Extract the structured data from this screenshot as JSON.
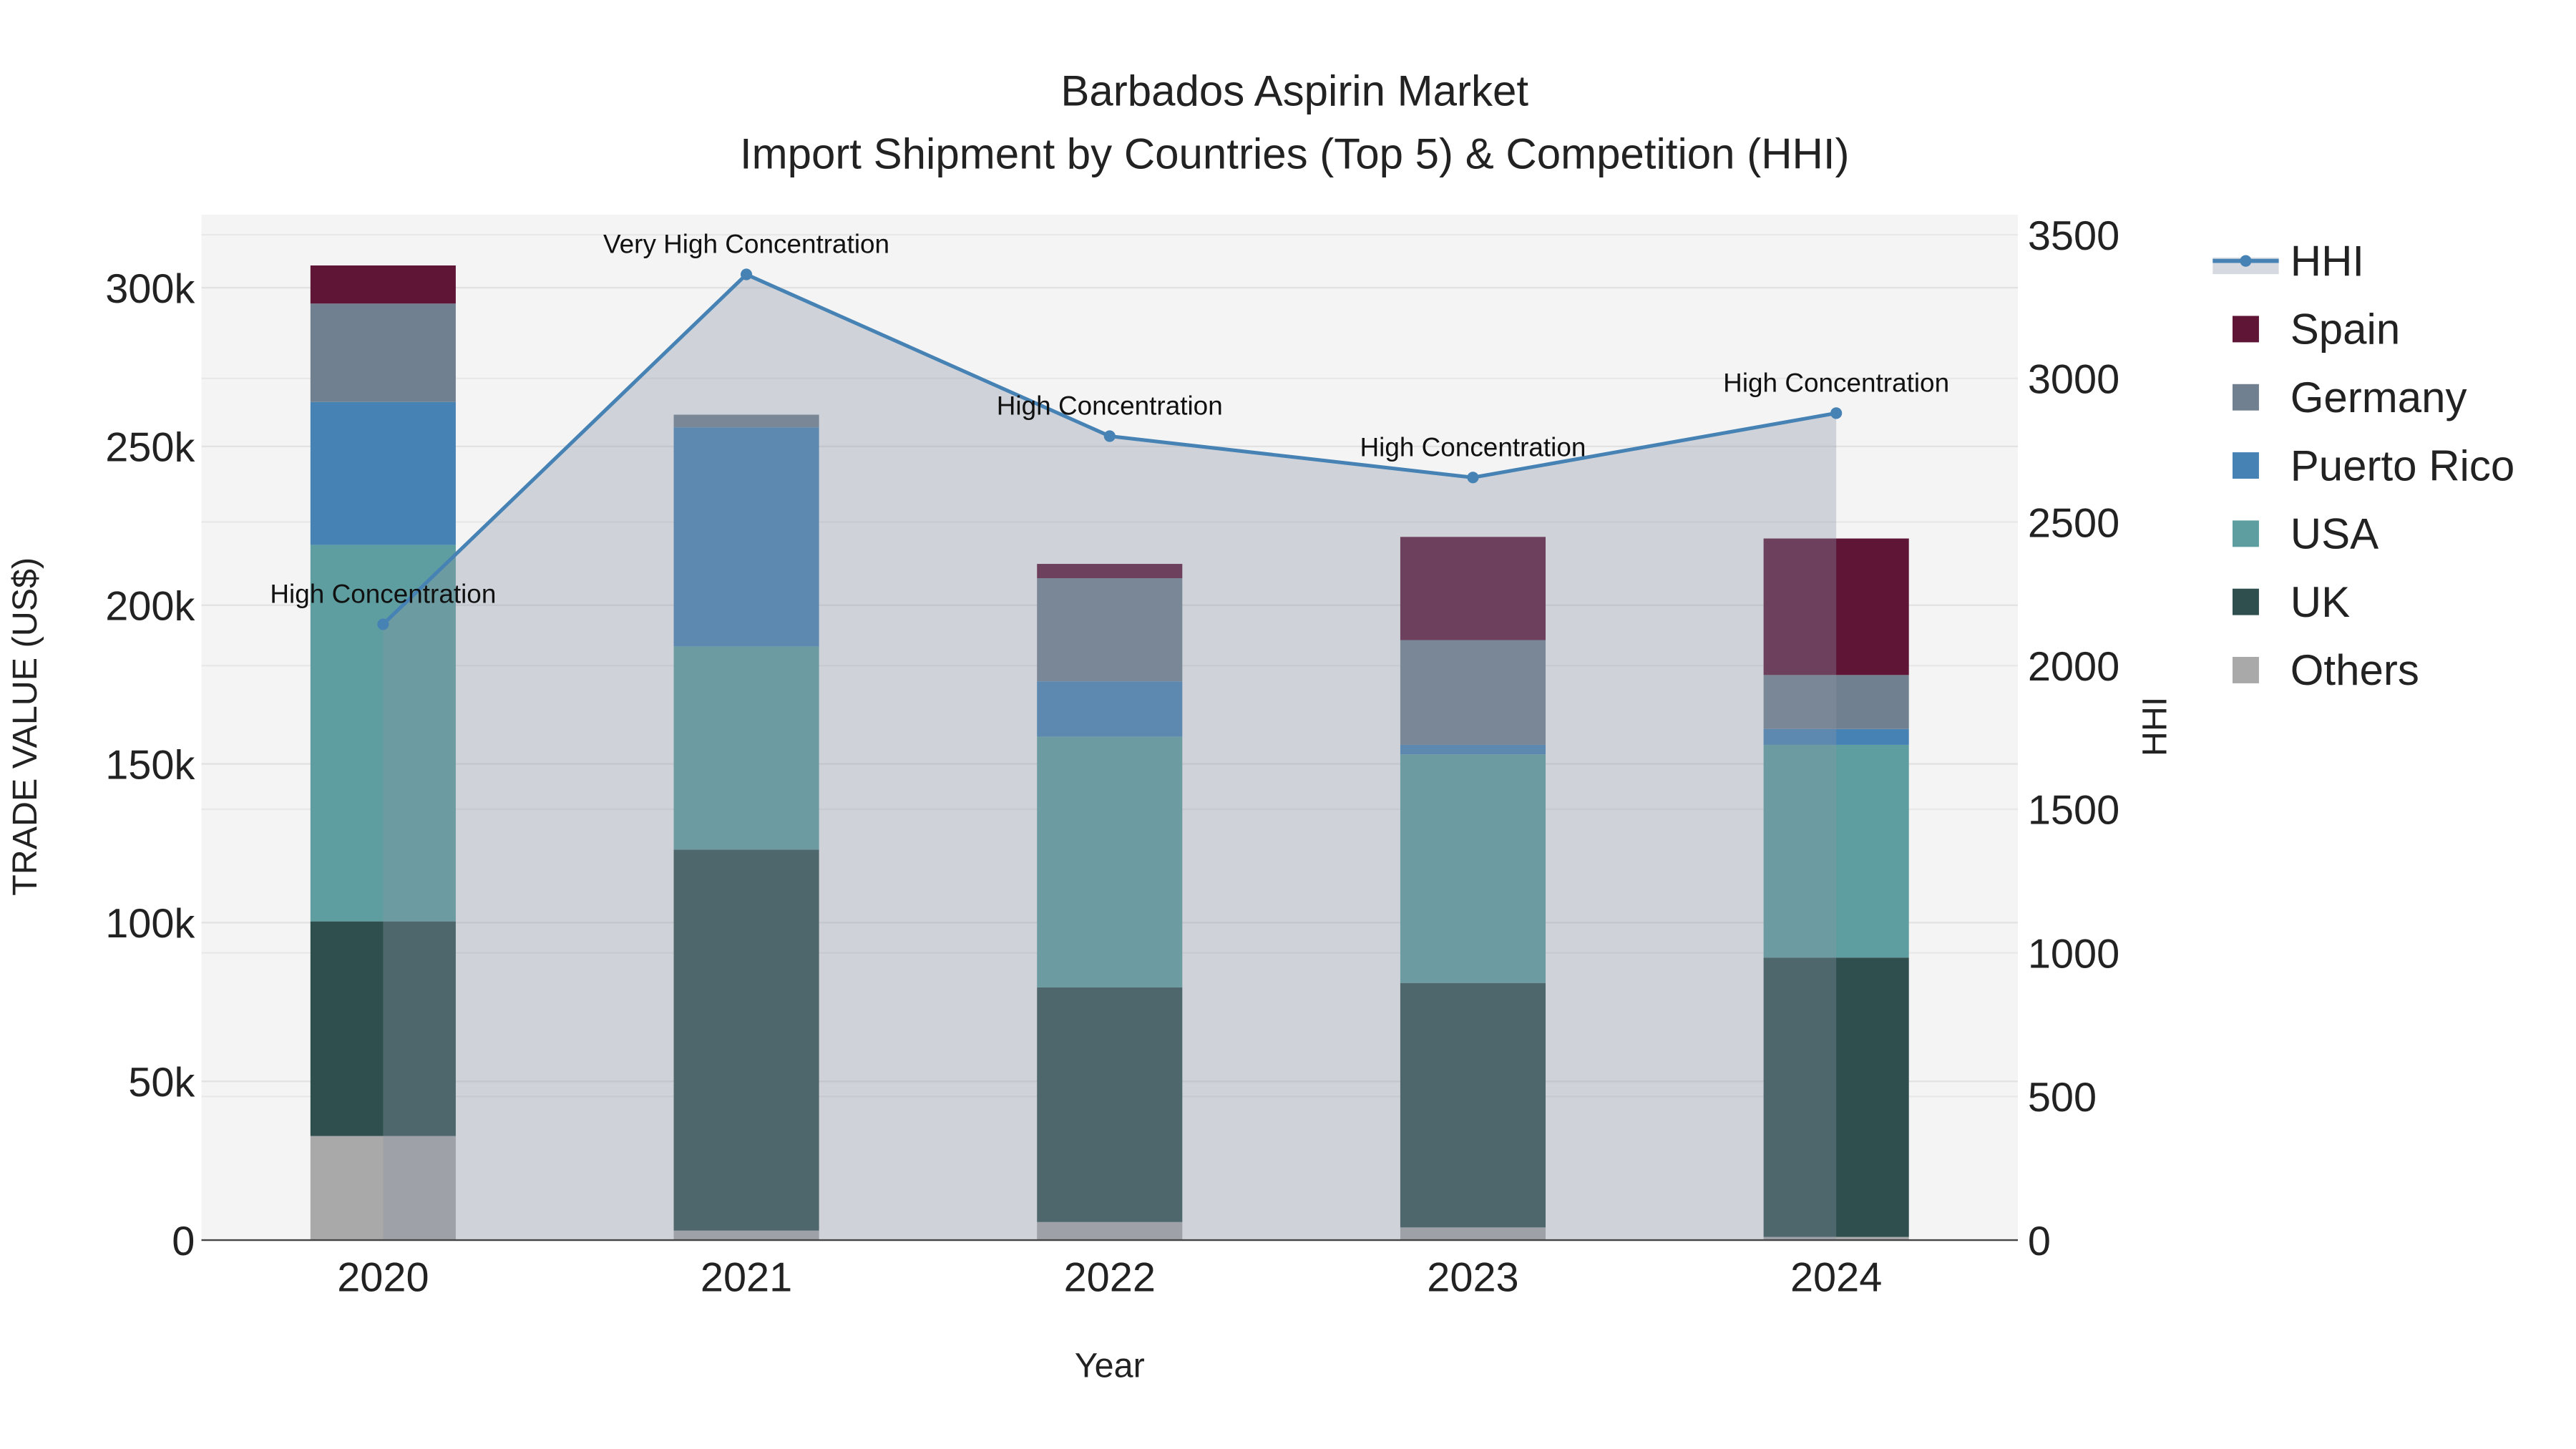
{
  "chart_data": {
    "type": "bar",
    "title": "Barbados Aspirin Market",
    "subtitle": "Import Shipment by Countries (Top 5) & Competition (HHI)",
    "xlabel": "Year",
    "ylabel": "TRADE VALUE (US$)",
    "y2label": "HHI",
    "categories": [
      "2020",
      "2021",
      "2022",
      "2023",
      "2024"
    ],
    "ylim": [
      0,
      323000
    ],
    "y2lim": [
      0,
      3570
    ],
    "yticks": [
      {
        "v": 0,
        "label": "0"
      },
      {
        "v": 50000,
        "label": "50k"
      },
      {
        "v": 100000,
        "label": "100k"
      },
      {
        "v": 150000,
        "label": "150k"
      },
      {
        "v": 200000,
        "label": "200k"
      },
      {
        "v": 250000,
        "label": "250k"
      },
      {
        "v": 300000,
        "label": "300k"
      }
    ],
    "y2ticks": [
      {
        "v": 0,
        "label": "0"
      },
      {
        "v": 500,
        "label": "500"
      },
      {
        "v": 1000,
        "label": "1000"
      },
      {
        "v": 1500,
        "label": "1500"
      },
      {
        "v": 2000,
        "label": "2000"
      },
      {
        "v": 2500,
        "label": "2500"
      },
      {
        "v": 3000,
        "label": "3000"
      },
      {
        "v": 3500,
        "label": "3500"
      }
    ],
    "series": [
      {
        "name": "Others",
        "color": "#a9a9a9",
        "values": [
          32800,
          3000,
          5700,
          4000,
          1000
        ]
      },
      {
        "name": "UK",
        "color": "#2f4f4f",
        "values": [
          67600,
          120000,
          73900,
          77000,
          88000
        ]
      },
      {
        "name": "USA",
        "color": "#5f9ea0",
        "values": [
          118600,
          64000,
          79000,
          72000,
          67000
        ]
      },
      {
        "name": "Puerto Rico",
        "color": "#4682b4",
        "values": [
          45000,
          69000,
          17400,
          3000,
          5000
        ]
      },
      {
        "name": "Germany",
        "color": "#708090",
        "values": [
          31000,
          4000,
          32500,
          33000,
          17000
        ]
      },
      {
        "name": "Spain",
        "color": "#5f1536",
        "values": [
          12000,
          0,
          4500,
          32500,
          43000
        ]
      }
    ],
    "hhi": {
      "name": "HHI",
      "color": "#4682b4",
      "values": [
        2144,
        3362,
        2799,
        2655,
        2879
      ],
      "annotations": [
        "High Concentration",
        "Very High Concentration",
        "High Concentration",
        "High Concentration",
        "High Concentration"
      ]
    },
    "legend": [
      "HHI",
      "Spain",
      "Germany",
      "Puerto Rico",
      "USA",
      "UK",
      "Others"
    ],
    "legend_position": "right",
    "grid": true
  }
}
